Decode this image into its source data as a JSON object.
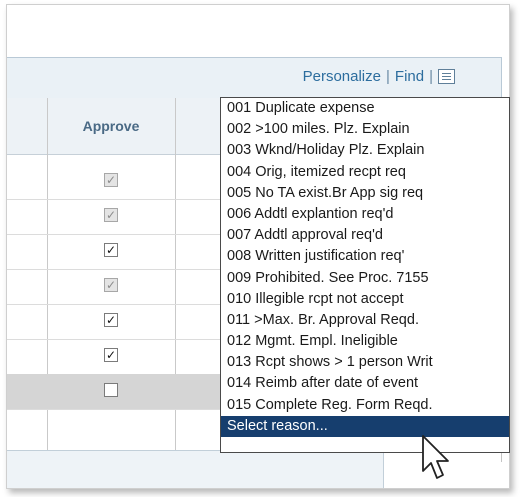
{
  "toolbar": {
    "personalize_label": "Personalize",
    "separator": "|",
    "find_label": "Find",
    "view_icon": "grid-view-icon"
  },
  "table": {
    "approve_header": "Approve",
    "rows": [
      {
        "state": "checked-disabled"
      },
      {
        "state": "checked-disabled"
      },
      {
        "state": "checked"
      },
      {
        "state": "checked-disabled"
      },
      {
        "state": "checked"
      },
      {
        "state": "checked"
      },
      {
        "state": "unchecked",
        "selected": true
      }
    ]
  },
  "dropdown": {
    "selected_label": "Select reason...",
    "options": [
      "001 Duplicate expense",
      "002 >100 miles. Plz. Explain",
      "003 Wknd/Holiday Plz. Explain",
      "004 Orig, itemized recpt req",
      "005 No TA exist.Br App sig req",
      "006 Addtl explantion req'd",
      "007 Addtl approval req'd",
      "008 Written justification req'",
      "009 Prohibited. See Proc. 7155",
      "010 Illegible rcpt not accept",
      "011 >Max. Br. Approval Reqd.",
      "012 Mgmt. Empl. Ineligible",
      "013 Rcpt shows > 1 person Writ",
      "014 Reimb after date of event",
      "015 Complete Reg. Form Reqd.",
      "Select reason..."
    ]
  },
  "cursor_icon": "arrow-pointer-icon"
}
